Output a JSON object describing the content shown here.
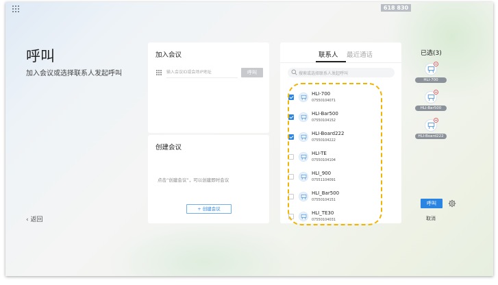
{
  "top_bar": {
    "meeting_id": "618 830"
  },
  "page": {
    "title": "呼叫",
    "subtitle": "加入会议或选择联系人发起呼叫",
    "back_label": "返回"
  },
  "join_card": {
    "title": "加入会议",
    "input_placeholder": "输入会议ID或会场IP地址",
    "call_label": "呼叫"
  },
  "create_card": {
    "title": "创建会议",
    "hint": "点击“创建会议”，可以创建即时会议",
    "button_label": "+ 创建会议"
  },
  "contacts_card": {
    "tabs": [
      {
        "label": "联系人",
        "active": true
      },
      {
        "label": "最近通话",
        "active": false
      }
    ],
    "search_placeholder": "搜索或选择联系人发起呼叫",
    "contacts": [
      {
        "name": "HLI-700",
        "number": "07550104071",
        "checked": true
      },
      {
        "name": "HLI-Bar500",
        "number": "07550104152",
        "checked": true
      },
      {
        "name": "HLI-Board222",
        "number": "07550104222",
        "checked": true
      },
      {
        "name": "HLI-TE",
        "number": "07550104104",
        "checked": false
      },
      {
        "name": "HLI_900",
        "number": "07551104091",
        "checked": false
      },
      {
        "name": "HLI_Bar500",
        "number": "07550104151",
        "checked": false
      },
      {
        "name": "HLI_TE30",
        "number": "07550104031",
        "checked": false
      }
    ]
  },
  "selected_panel": {
    "header": "已选(3)",
    "items": [
      {
        "label": "HLI-700"
      },
      {
        "label": "HLI-Bar500"
      },
      {
        "label": "HLI-Board222"
      }
    ],
    "call_label": "呼叫",
    "cancel_label": "取消"
  },
  "colors": {
    "accent": "#2a84e2",
    "highlight": "#f0b400",
    "disabled_button": "#c7c9cc"
  },
  "icons": {
    "app_grid": "app-grid-icon",
    "dial": "dialpad-icon",
    "search": "search-icon",
    "device": "terminal-device-icon",
    "remove": "remove-minus-icon",
    "settings": "gear-icon",
    "back": "chevron-left-icon"
  }
}
